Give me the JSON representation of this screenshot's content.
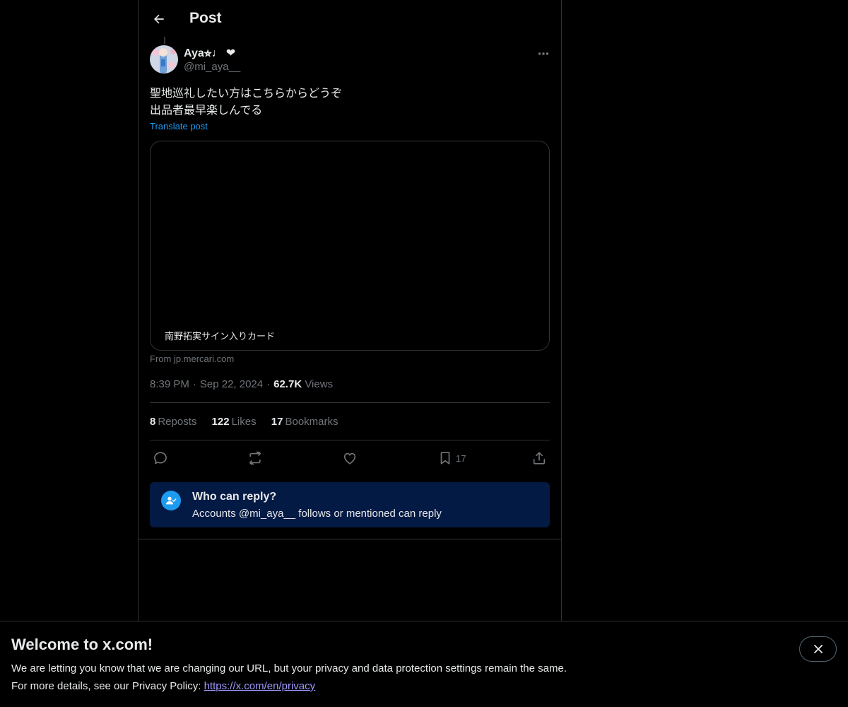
{
  "header": {
    "title": "Post",
    "back_icon": "arrow-left-icon"
  },
  "post": {
    "author": {
      "name": "Aya⭐︎♩ ❤",
      "handle": "@mi_aya__"
    },
    "text_lines": [
      "聖地巡礼したい方はこちらからどうぞ",
      "出品者最早楽しんでる"
    ],
    "translate_label": "Translate post",
    "card": {
      "caption": "南野拓実サイン入りカード",
      "source": "From jp.mercari.com"
    },
    "time": "8:39 PM",
    "date": "Sep 22, 2024",
    "views_count": "62.7K",
    "views_label": "Views",
    "stats": {
      "reposts_count": "8",
      "reposts_label": "Reposts",
      "likes_count": "122",
      "likes_label": "Likes",
      "bookmarks_count": "17",
      "bookmarks_label": "Bookmarks"
    },
    "actions": {
      "bookmark_count": "17"
    },
    "reply_restriction": {
      "title": "Who can reply?",
      "subtitle": "Accounts @mi_aya__ follows or mentioned can reply"
    }
  },
  "banner": {
    "title": "Welcome to x.com!",
    "line1": "We are letting you know that we are changing our URL, but your privacy and data protection settings remain the same.",
    "line2_prefix": "For more details, see our Privacy Policy: ",
    "link": "https://x.com/en/privacy"
  },
  "colors": {
    "accent": "#1d9bf0",
    "background": "#000000",
    "reply_box": "#031a45",
    "link": "#9f98ff"
  }
}
